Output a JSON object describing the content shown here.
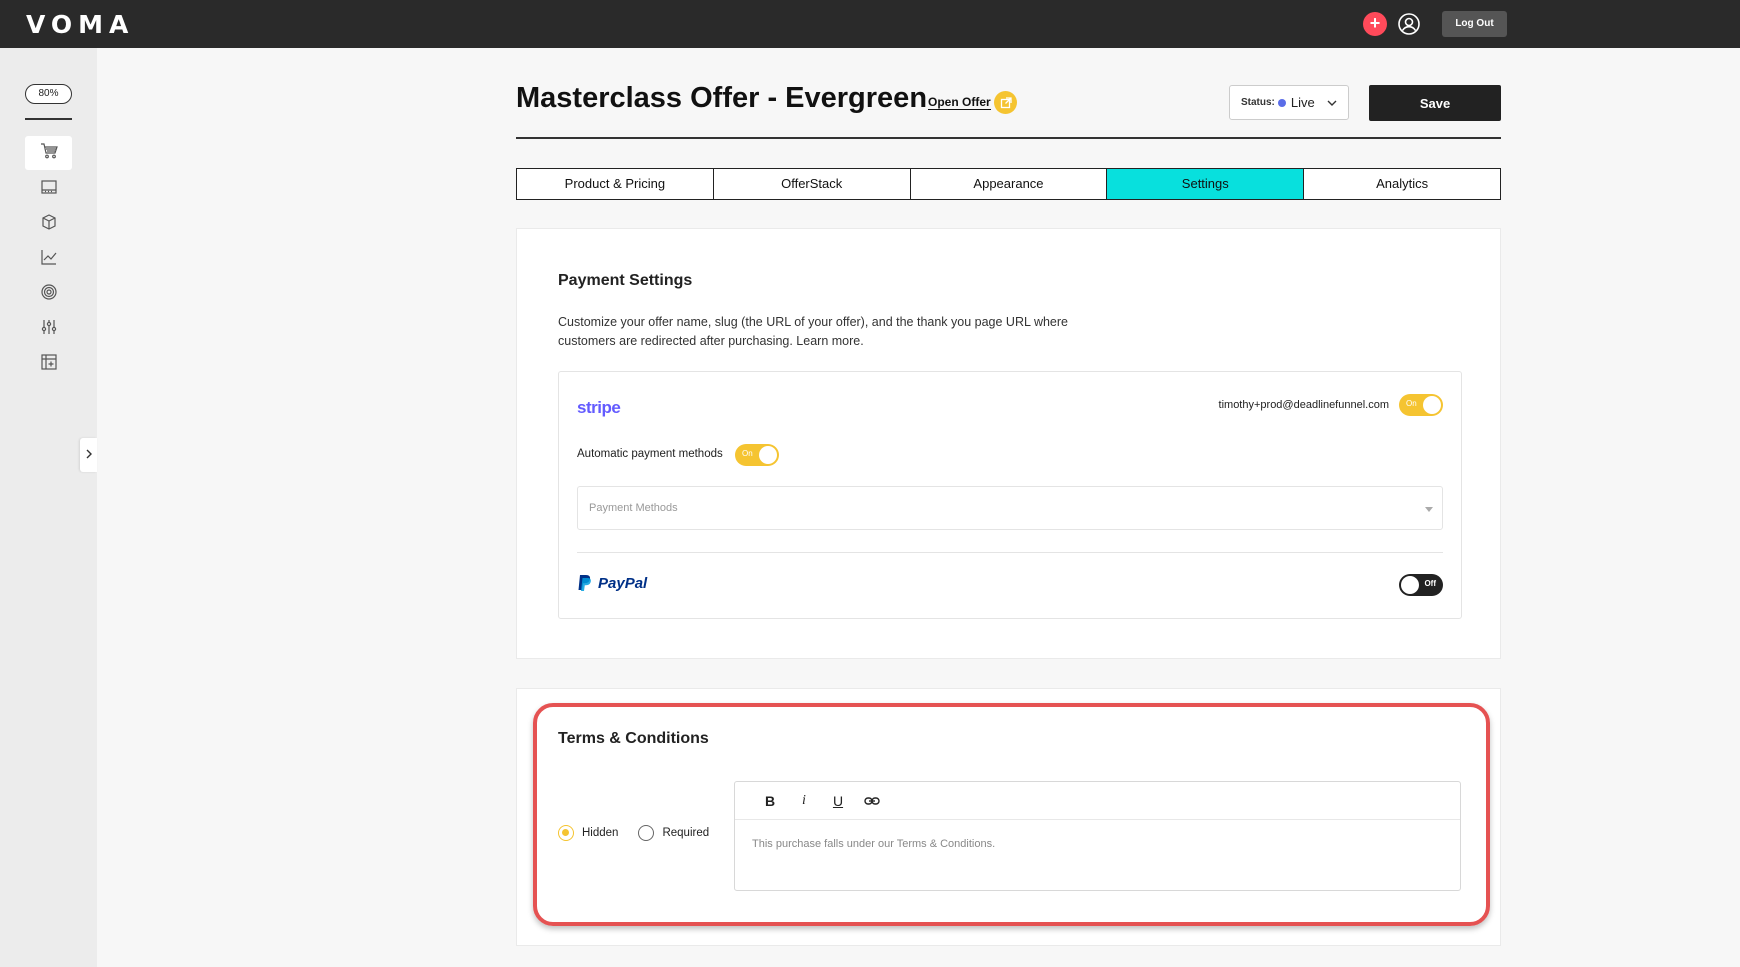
{
  "topbar": {
    "logo": "VOMA",
    "plus_label": "+",
    "logout_label": "Log Out",
    "icons": [
      "plus-icon",
      "user-circle-icon"
    ]
  },
  "sidebar": {
    "zoom": "80%",
    "items": [
      {
        "icon": "cart-icon",
        "active": true
      },
      {
        "icon": "terminal-window-icon",
        "active": false
      },
      {
        "icon": "box-icon",
        "active": false
      },
      {
        "icon": "chart-line-icon",
        "active": false
      },
      {
        "icon": "target-icon",
        "active": false
      },
      {
        "icon": "sliders-icon",
        "active": false
      },
      {
        "icon": "add-grid-icon",
        "active": false
      }
    ],
    "collapse_icon": "chevron-right-icon"
  },
  "header": {
    "title": "Masterclass Offer - Evergreen",
    "open_offer": "Open Offer",
    "status_label": "Status:",
    "status_value": "Live",
    "save_label": "Save"
  },
  "tabs": [
    {
      "label": "Product & Pricing",
      "active": false
    },
    {
      "label": "OfferStack",
      "active": false
    },
    {
      "label": "Appearance",
      "active": false
    },
    {
      "label": "Settings",
      "active": true
    },
    {
      "label": "Analytics",
      "active": false
    }
  ],
  "payment": {
    "title": "Payment Settings",
    "description": "Customize your offer name, slug (the URL of your offer), and the thank you page URL where customers are redirected after purchasing. Learn more.",
    "stripe": {
      "logo": "stripe",
      "email": "timothy+prod@deadlinefunnel.com",
      "toggle": "On",
      "auto_label": "Automatic payment methods",
      "auto_toggle": "On",
      "methods_placeholder": "Payment Methods"
    },
    "paypal": {
      "logo": "PayPal",
      "toggle": "Off"
    }
  },
  "terms": {
    "title": "Terms & Conditions",
    "options": [
      {
        "label": "Hidden",
        "checked": true
      },
      {
        "label": "Required",
        "checked": false
      }
    ],
    "toolbar": [
      "B",
      "i",
      "U",
      "link-icon"
    ],
    "body": "This purchase falls under our Terms & Conditions."
  },
  "colors": {
    "accent_tab": "#08e0dd",
    "toggle_on": "#f5c431",
    "highlight": "#e55252",
    "stripe": "#635bff"
  }
}
